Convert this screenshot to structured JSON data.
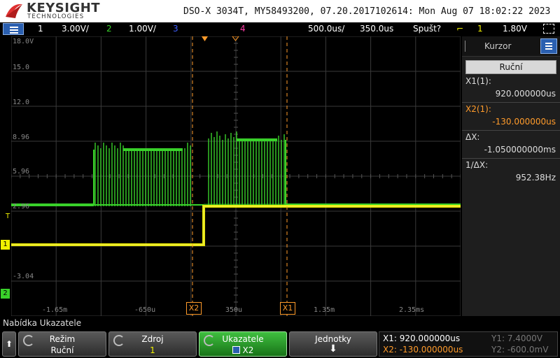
{
  "header": {
    "brand": "KEYSIGHT",
    "brand_sub": "TECHNOLOGIES",
    "scope_info": "DSO-X 3034T, MY58493200, 07.20.2017102614: Mon Aug 07 18:02:22 2023"
  },
  "channel_bar": {
    "ch1_num": "1",
    "ch1_scale": "3.00V/",
    "ch2_num": "2",
    "ch2_scale": "1.00V/",
    "ch3_num": "3",
    "ch4_num": "4",
    "timebase": "500.0us/",
    "delay": "350.0us",
    "trigger_mode": "Spušt?",
    "trigger_source": "1",
    "trigger_level": "1.80V"
  },
  "grid": {
    "y_labels": [
      "18.0V",
      "15.0",
      "12.0",
      "8.96",
      "5.96",
      "2.96",
      "-3.04"
    ],
    "x_labels": [
      "-1.65m",
      "-650u",
      "350u",
      "1.35m",
      "2.35ms"
    ],
    "cursor_x1_label": "X1",
    "cursor_x2_label": "X2",
    "ch1_marker": "1",
    "ch2_marker": "2",
    "trigger_marker": "T"
  },
  "cursor_panel": {
    "title": "Kurzor",
    "mode": "Ruční",
    "x1_label": "X1(1):",
    "x1_value": "920.000000us",
    "x2_label": "X2(1):",
    "x2_value": "-130.000000us",
    "dx_label": "ΔX:",
    "dx_value": "-1.050000000ms",
    "inv_dx_label": "1/ΔX:",
    "inv_dx_value": "952.38Hz"
  },
  "softkeys": {
    "menu_title": "Nabídka Ukazatele",
    "mode_title": "Režim",
    "mode_value": "Ruční",
    "source_title": "Zdroj",
    "source_value": "1",
    "cursors_title": "Ukazatele",
    "cursors_value": "X2",
    "units_title": "Jednotky"
  },
  "readout": {
    "x1": "X1: 920.000000us",
    "x2": "X2: -130.000000us",
    "y1": "Y1: 7.4000V",
    "y2": "Y2: -600.0mV"
  },
  "colors": {
    "ch1": "#f0f000",
    "ch2": "#39d12a",
    "ch3": "#3f5fff",
    "ch4": "#ff3aa8",
    "cursor": "#ff9b2b",
    "accent_blue": "#2a5fb0"
  },
  "icons": [
    "keysight-logo-icon",
    "menu-icon",
    "screenshot-icon",
    "trigger-rising-icon",
    "rotary-knob-icon",
    "arrow-up-icon",
    "arrow-down-icon"
  ]
}
